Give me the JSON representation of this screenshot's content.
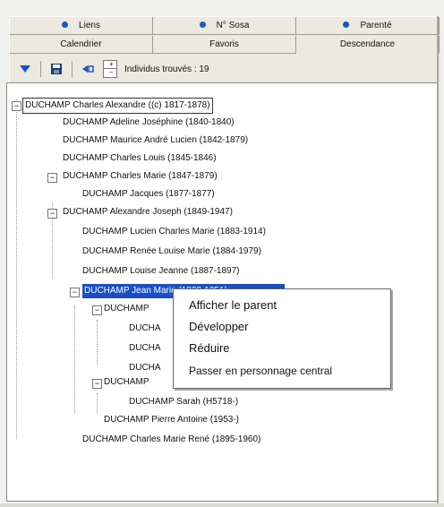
{
  "tabs_row1": [
    {
      "label": "Liens"
    },
    {
      "label": "N° Sosa"
    },
    {
      "label": "Parenté"
    }
  ],
  "tabs_row2": [
    {
      "label": "Calendrier"
    },
    {
      "label": "Favoris"
    },
    {
      "label": "Descendance",
      "active": true
    }
  ],
  "toolbar": {
    "icons": [
      "filter-icon",
      "save-icon",
      "refresh-icon",
      "spin-icon"
    ],
    "count_label": "Individus trouvés : 19"
  },
  "tree": [
    {
      "text": "DUCHAMP Charles Alexandre ((c) 1817-1878)"
    },
    {
      "text": "DUCHAMP Adeline Joséphine (1840-1840)"
    },
    {
      "text": "DUCHAMP Maurice André Lucien (1842-1879)"
    },
    {
      "text": "DUCHAMP Charles Louis (1845-1846)"
    },
    {
      "text": "DUCHAMP Charles Marie (1847-1879)"
    },
    {
      "text": "DUCHAMP Jacques (1877-1877)"
    },
    {
      "text": "DUCHAMP Alexandre Joseph (1849-1947)"
    },
    {
      "text": "DUCHAMP Lucien Charles Marie (1883-1914)"
    },
    {
      "text": "DUCHAMP Renée Louise Marie (1884-1979)"
    },
    {
      "text": "DUCHAMP Louise Jeanne (1887-1897)"
    },
    {
      "text": "DUCHAMP Jean Marie (1888-1951)"
    },
    {
      "text": "DUCHAMP"
    },
    {
      "text": "DUCHA"
    },
    {
      "text": "DUCHA"
    },
    {
      "text": "DUCHA"
    },
    {
      "text": "DUCHAMP"
    },
    {
      "text": "DUCHAMP Sarah (H5718-)"
    },
    {
      "text": "DUCHAMP Pierre Antoine (1953-)"
    },
    {
      "text": "DUCHAMP Charles Marie René (1895-1960)"
    }
  ],
  "context_menu": [
    {
      "label": "Afficher le parent"
    },
    {
      "label": "Développer"
    },
    {
      "label": "Réduire"
    },
    {
      "label": "Passer en personnage central"
    }
  ]
}
